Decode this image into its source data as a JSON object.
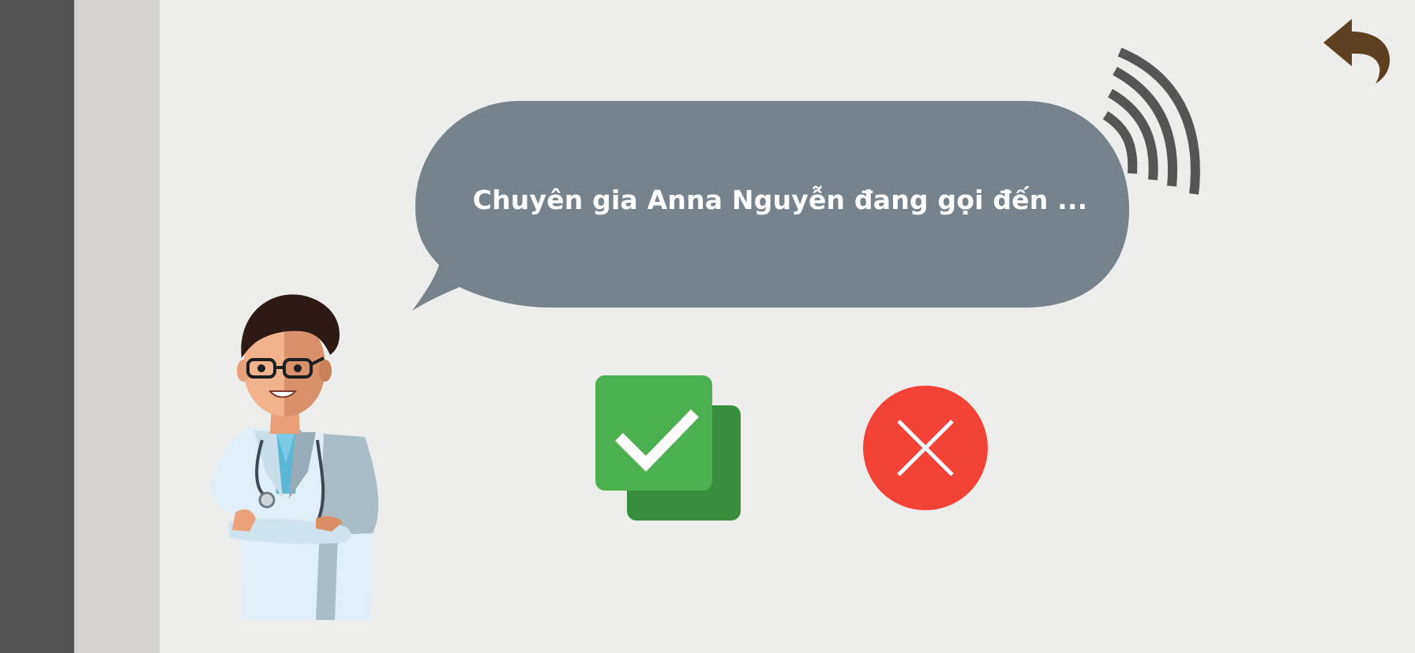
{
  "call": {
    "message": "Chuyên gia Anna Nguyễn đang gọi đến ..."
  },
  "icons": {
    "back": "undo-arrow-icon",
    "signal": "call-signal-icon",
    "accept": "checkmark-icon",
    "decline": "close-x-icon",
    "caller": "doctor-avatar"
  },
  "colors": {
    "sidebar_dark": "#545454",
    "sidebar_light": "#d4d3d1",
    "background": "#ededeb",
    "bubble": "#77838c",
    "accept_front": "#4caf50",
    "accept_back": "#388e3c",
    "decline": "#f44336",
    "back_arrow": "#5d4020",
    "signal_waves": "#555555"
  }
}
